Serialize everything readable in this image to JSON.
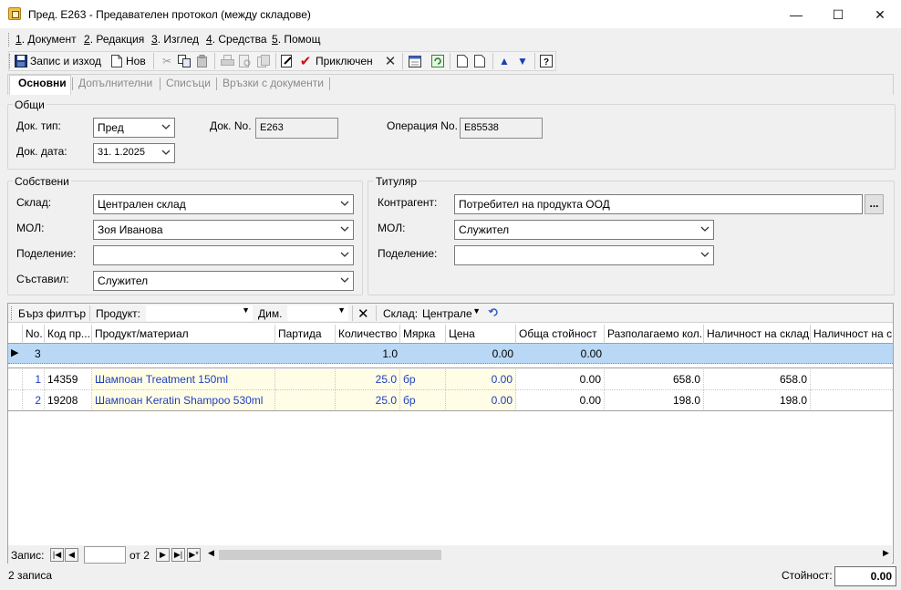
{
  "window": {
    "title": "Пред. E263 - Предавателен протокол (между складове)",
    "minimize": "—",
    "maximize": "☐",
    "close": "✕"
  },
  "menu": [
    {
      "key": "1",
      "label": ". Документ"
    },
    {
      "key": "2",
      "label": ". Редакция"
    },
    {
      "key": "3",
      "label": ". Изглед"
    },
    {
      "key": "4",
      "label": ". Средства"
    },
    {
      "key": "5",
      "label": ". Помощ"
    }
  ],
  "toolbar": {
    "save_exit": "Запис и изход",
    "new": "Нов",
    "finished": "Приключен"
  },
  "tabs": [
    "Основни",
    "Допълнителни",
    "Списъци",
    "Връзки с документи"
  ],
  "general": {
    "title": "Общи",
    "doc_type_label": "Док. тип:",
    "doc_type_value": "Пред",
    "doc_no_label": "Док. No.",
    "doc_no_value": "E263",
    "op_no_label": "Операция No.",
    "op_no_value": "E85538",
    "doc_date_label": "Док. дата:",
    "doc_date_value": "31.  1.2025"
  },
  "own": {
    "title": "Собствени",
    "warehouse_label": "Склад:",
    "warehouse_value": "Централен склад",
    "mol_label": "МОЛ:",
    "mol_value": "Зоя Иванова",
    "division_label": "Поделение:",
    "division_value": "",
    "author_label": "Съставил:",
    "author_value": "Служител"
  },
  "holder": {
    "title": "Титуляр",
    "partner_label": "Контрагент:",
    "partner_value": "Потребител на продукта ООД",
    "partner_btn": "...",
    "mol_label": "МОЛ:",
    "mol_value": "Служител",
    "division_label": "Поделение:",
    "division_value": ""
  },
  "filter": {
    "quick_filter": "Бърз филтър",
    "product_label": "Продукт:",
    "dim_label": "Дим.",
    "warehouse_label": "Склад:",
    "warehouse_value": "Централе"
  },
  "grid": {
    "columns": [
      "No.",
      "Код пр...",
      "Продукт/материал",
      "Партида",
      "Количество",
      "Мярка",
      "Цена",
      "Обща стойност",
      "Разполагаемо кол.",
      "Наличност на склад",
      "Наличност на с"
    ],
    "new_row": {
      "no": "3",
      "qty": "1.0",
      "price": "0.00",
      "total": "0.00"
    },
    "rows": [
      {
        "no": "1",
        "code": "14359",
        "product": "Шампоан Treatment 150ml",
        "batch": "",
        "qty": "25.0",
        "unit": "бр",
        "price": "0.00",
        "total": "0.00",
        "available": "658.0",
        "stock": "658.0"
      },
      {
        "no": "2",
        "code": "19208",
        "product": "Шампоан Keratin Shampoo 530ml",
        "batch": "",
        "qty": "25.0",
        "unit": "бр",
        "price": "0.00",
        "total": "0.00",
        "available": "198.0",
        "stock": "198.0"
      }
    ]
  },
  "nav": {
    "record_label": "Запис:",
    "record_value": "",
    "of_label": "от 2"
  },
  "status": {
    "count": "2 записа",
    "value_label": "Стойност:",
    "value": "0.00"
  }
}
